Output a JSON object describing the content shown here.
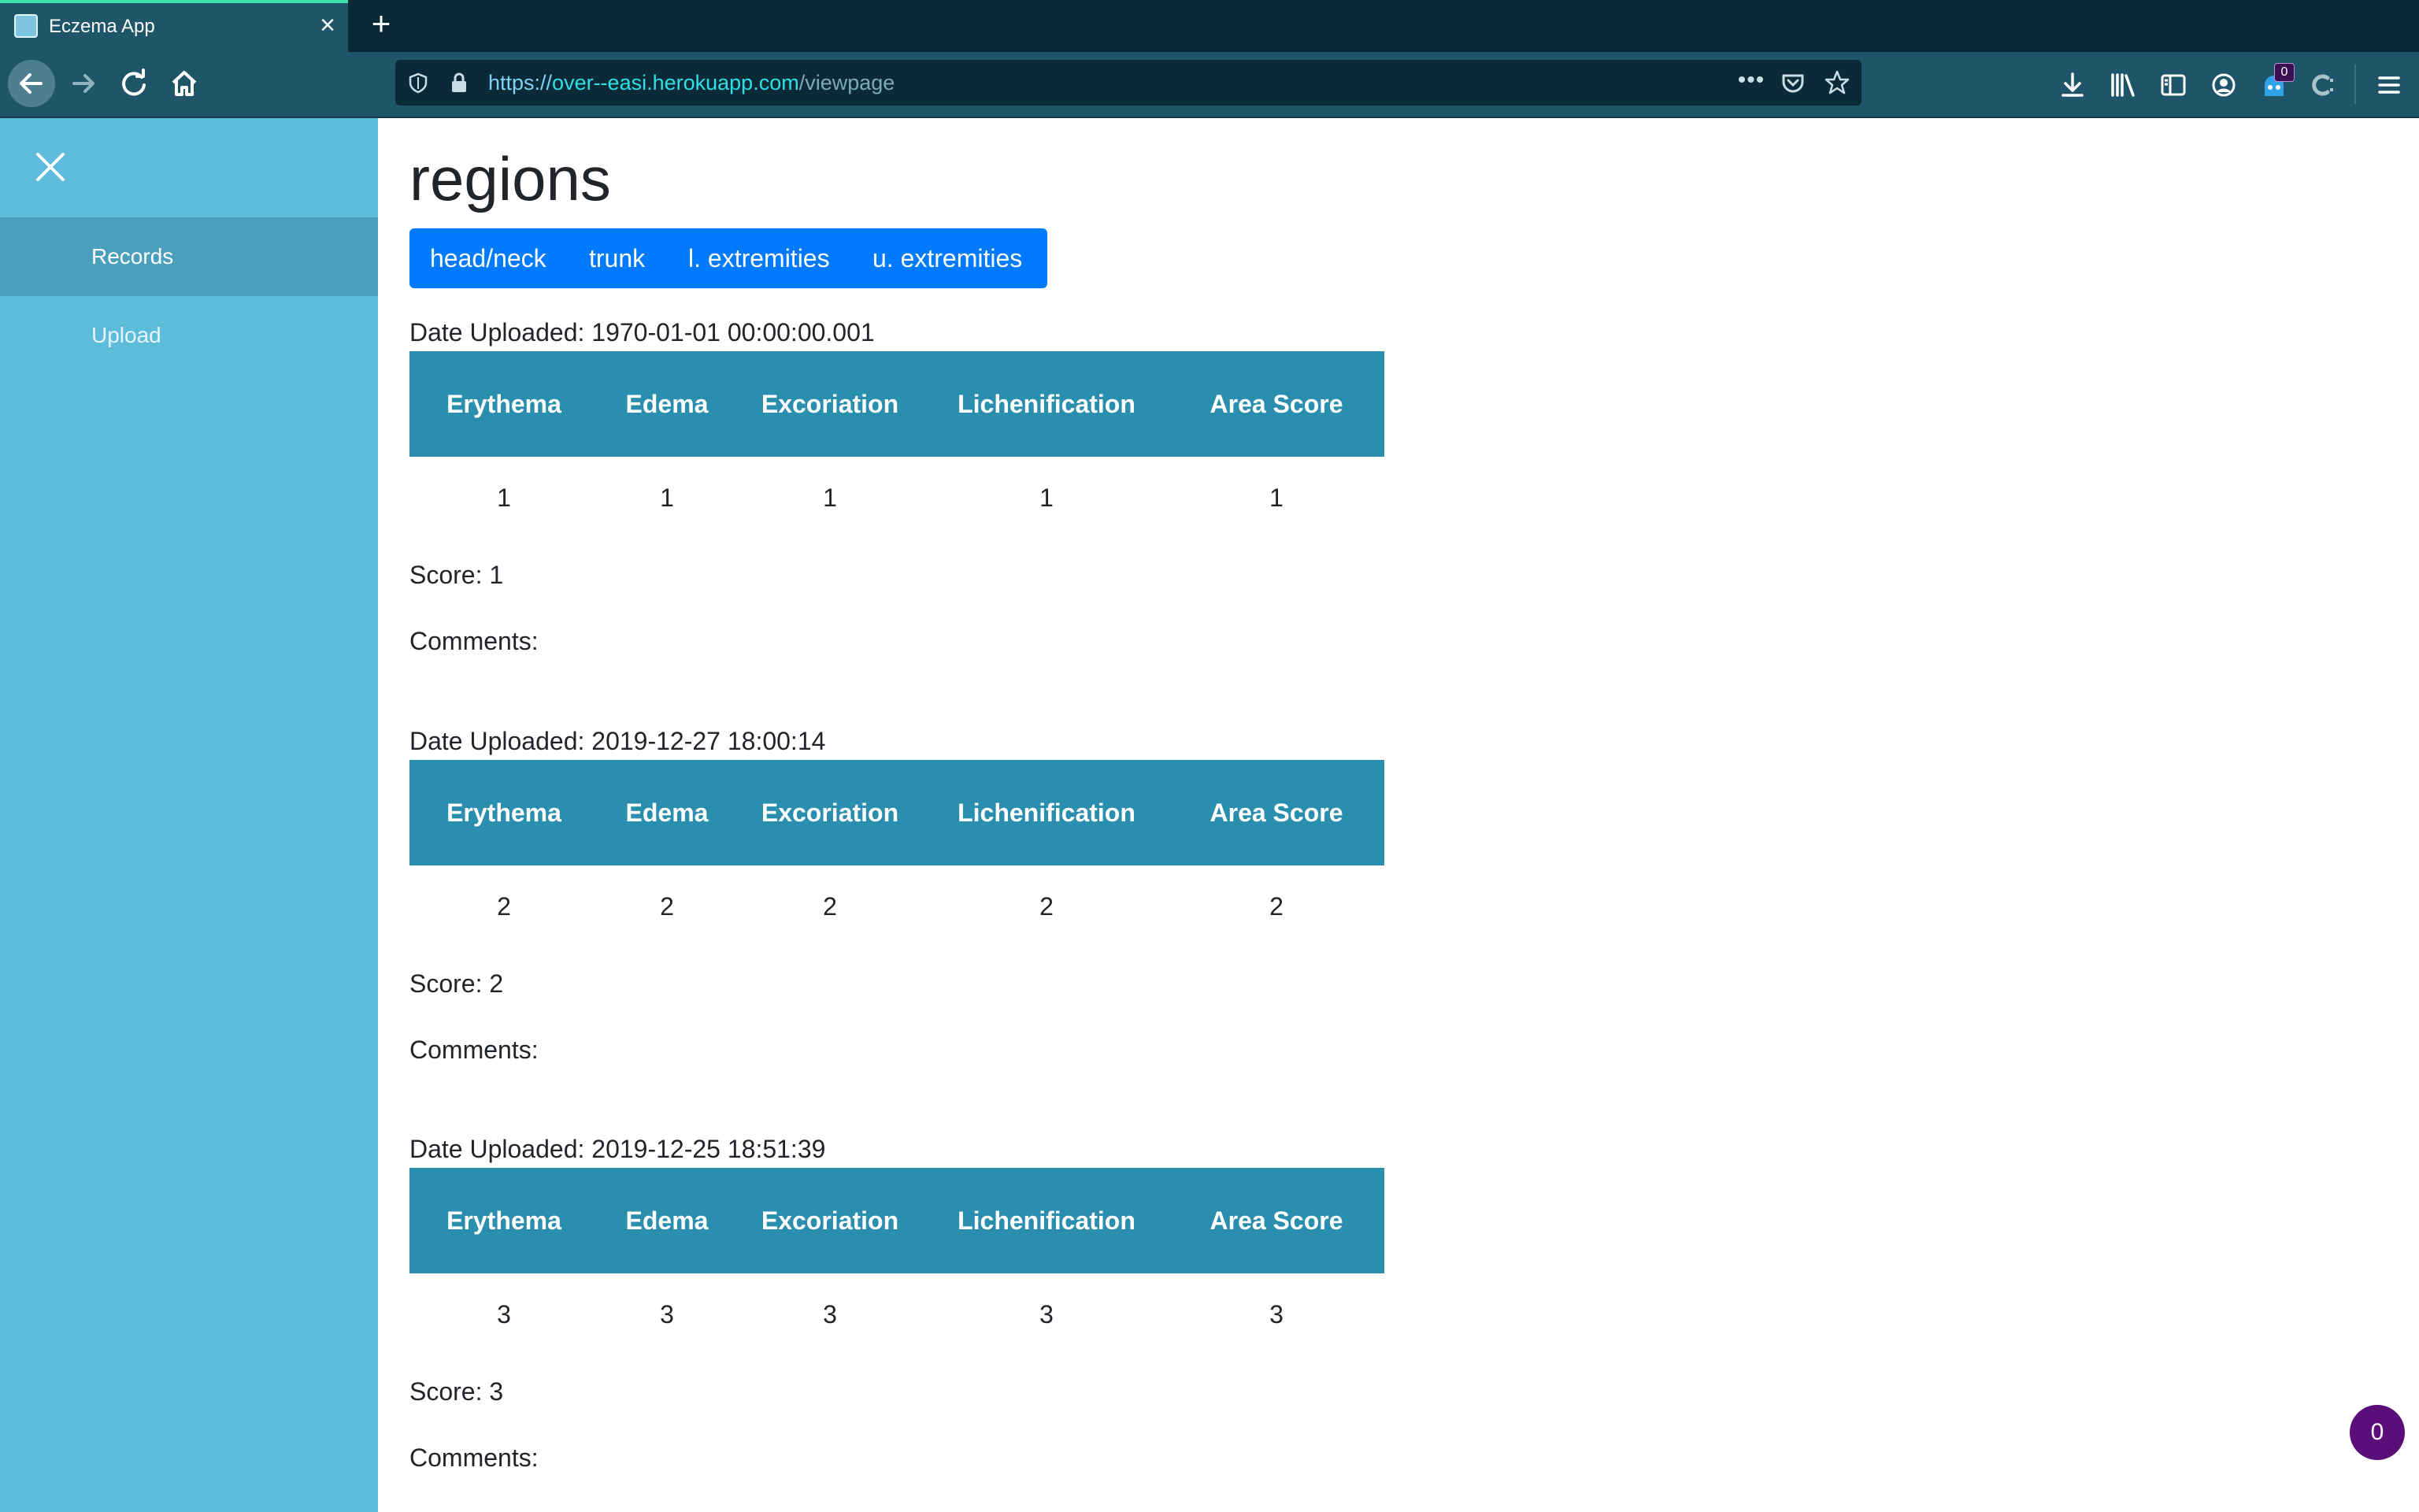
{
  "browser": {
    "tab_title": "Eczema App",
    "url_scheme": "https://",
    "url_host": "over--easi.herokuapp.com",
    "url_path": "/viewpage",
    "extension_badge": "0"
  },
  "sidebar": {
    "items": [
      {
        "label": "Records"
      },
      {
        "label": "Upload"
      }
    ]
  },
  "main": {
    "title": "regions",
    "region_tabs": [
      "head/neck",
      "trunk",
      "l. extremities",
      "u. extremities"
    ],
    "columns": [
      "Erythema",
      "Edema",
      "Excoriation",
      "Lichenification",
      "Area Score"
    ],
    "records": [
      {
        "date": "Date Uploaded: 1970-01-01 00:00:00.001",
        "values": [
          "1",
          "1",
          "1",
          "1",
          "1"
        ],
        "score": "Score: 1",
        "comments": "Comments:"
      },
      {
        "date": "Date Uploaded: 2019-12-27 18:00:14",
        "values": [
          "2",
          "2",
          "2",
          "2",
          "2"
        ],
        "score": "Score: 2",
        "comments": "Comments:"
      },
      {
        "date": "Date Uploaded: 2019-12-25 18:51:39",
        "values": [
          "3",
          "3",
          "3",
          "3",
          "3"
        ],
        "score": "Score: 3",
        "comments": "Comments:"
      }
    ]
  },
  "chat_badge": "0",
  "colors": {
    "sidebar": "#5ebcdb",
    "table_header": "#2a8fae",
    "region_nav": "#007bff",
    "chrome": "#1e5568"
  }
}
